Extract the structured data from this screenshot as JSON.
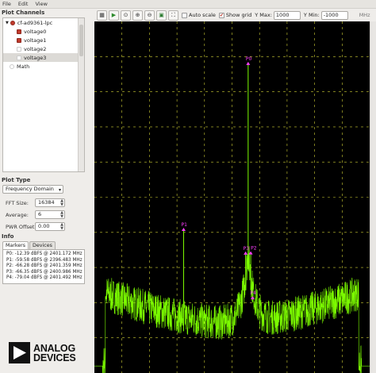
{
  "menu": [
    "File",
    "Edit",
    "View"
  ],
  "plot_channels": {
    "title": "Plot Channels",
    "device": "cf-ad9361-lpc",
    "channels": [
      {
        "label": "voltage0",
        "checked": true
      },
      {
        "label": "voltage1",
        "checked": true
      },
      {
        "label": "voltage2",
        "checked": false
      },
      {
        "label": "voltage3",
        "checked": false
      }
    ],
    "math": "Math"
  },
  "plot_type": {
    "title": "Plot Type",
    "domain": "Frequency Domain",
    "fft_size_label": "FFT Size:",
    "fft_size": "16384",
    "average_label": "Average:",
    "average": "6",
    "pwr_offset_label": "PWR Offset:",
    "pwr_offset": "0.00"
  },
  "info": {
    "title": "Info",
    "tabs": [
      "Markers",
      "Devices"
    ],
    "active_tab": "Markers",
    "markers": [
      "P0: -12.39 dBFS @ 2401.172 MHz",
      "P1: -59.58 dBFS @ 2396.483 MHz",
      "P2: -66.28 dBFS @ 2401.359 MHz",
      "P3: -66.35 dBFS @ 2400.986 MHz",
      "P4: -79.04 dBFS @ 2401.492 MHz"
    ]
  },
  "logo": {
    "line1": "ANALOG",
    "line2": "DEVICES"
  },
  "toolbar": {
    "auto_scale_label": "Auto scale",
    "auto_scale": false,
    "show_grid_label": "Show grid",
    "show_grid": true,
    "ymax_label": "Y Max:",
    "ymax": "1000",
    "ymin_label": "Y Min:",
    "ymin": "-1000",
    "unit": "MHz"
  },
  "plot": {
    "background": "#000000",
    "trace_color": "#7cfc00",
    "marker_color": "#ff40ff",
    "grid_color": "#cccc33",
    "marker_labels": [
      "P0",
      "P1",
      "P2",
      "P3",
      "P4"
    ]
  },
  "chart_data": {
    "type": "line",
    "description_units": "dBFS vs MHz",
    "y_range": [
      -100,
      0
    ],
    "x_range_mhz": [
      2390,
      2410
    ],
    "markers": [
      {
        "name": "P0",
        "x": 2401.172,
        "y": -12.39
      },
      {
        "name": "P1",
        "x": 2396.483,
        "y": -59.58
      },
      {
        "name": "P2",
        "x": 2401.359,
        "y": -66.28
      },
      {
        "name": "P3",
        "x": 2400.986,
        "y": -66.35
      },
      {
        "name": "P4",
        "x": 2401.492,
        "y": -79.04
      }
    ],
    "grid": true
  }
}
